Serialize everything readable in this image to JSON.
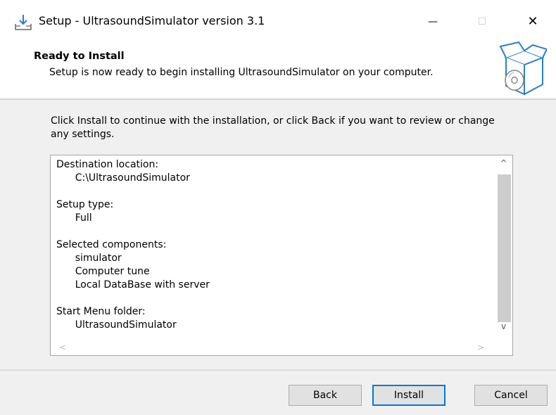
{
  "window": {
    "title": "Setup - UltrasoundSimulator version 3.1",
    "minimize": "—",
    "maximize": "☐",
    "close": "✕"
  },
  "header": {
    "title": "Ready to Install",
    "subtitle": "Setup is now ready to begin installing UltrasoundSimulator on your computer."
  },
  "body": {
    "intro": "Click Install to continue with the installation, or click Back if you want to review or change any settings.",
    "memo_lines": [
      "Destination location:",
      "      C:\\UltrasoundSimulator",
      "",
      "Setup type:",
      "      Full",
      "",
      "Selected components:",
      "      simulator",
      "      Computer tune",
      "      Local DataBase with server",
      "",
      "Start Menu folder:",
      "      UltrasoundSimulator"
    ],
    "scroll_up": "^",
    "scroll_down": "v",
    "scroll_left": "<",
    "scroll_right": ">"
  },
  "buttons": {
    "back": "Back",
    "install": "Install",
    "cancel": "Cancel"
  }
}
